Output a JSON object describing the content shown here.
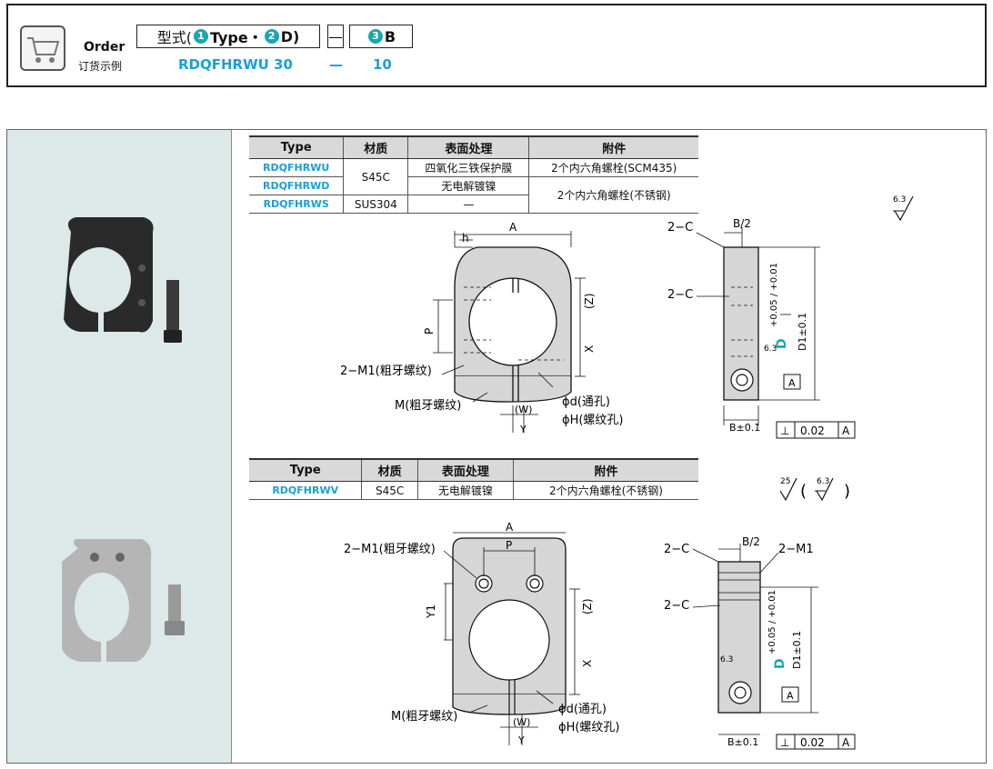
{
  "order": {
    "title_en": "Order",
    "title_cn": "订货示例",
    "type_label_prefix": "型式(",
    "type_label_part1": "Type・",
    "type_label_part2": "D)",
    "circle1": "1",
    "circle2": "2",
    "circle3": "3",
    "b_label": "B",
    "dash": "—",
    "example_type": "RDQFHRWU 30",
    "example_b": "10"
  },
  "table1": {
    "headers": [
      "Type",
      "材质",
      "表面处理",
      "附件"
    ],
    "rows": [
      {
        "type": "RDQFHRWU",
        "material": "S45C",
        "surface": "四氧化三铁保护膜",
        "accessory": "2个内六角螺栓(SCM435)"
      },
      {
        "type": "RDQFHRWD",
        "surface": "无电解镀镍",
        "accessory": "2个内六角螺栓(不锈钢)"
      },
      {
        "type": "RDQFHRWS",
        "material": "SUS304",
        "surface": "—"
      }
    ]
  },
  "table2": {
    "headers": [
      "Type",
      "材质",
      "表面处理",
      "附件"
    ],
    "rows": [
      {
        "type": "RDQFHRWV",
        "material": "S45C",
        "surface": "无电解镀镍",
        "accessory": "2个内六角螺栓(不锈钢)"
      }
    ]
  },
  "drawing1": {
    "A": "A",
    "h": "h",
    "P": "P",
    "Z": "(Z)",
    "X": "X",
    "m1": "2−M1(粗牙螺纹)",
    "m": "M(粗牙螺纹)",
    "W": "(W)",
    "Y": "Y",
    "phid": "ϕd(通孔)",
    "phiH": "ϕH(螺纹孔)",
    "B2": "B/2",
    "C1": "2−C",
    "C2": "2−C",
    "D_tol": "+0.05 / +0.01",
    "D": "D",
    "D1": "D1±0.1",
    "A_ref": "A",
    "r63": "6.3",
    "B_tol": "B±0.1",
    "perp": "⊥",
    "perp_val": "0.02",
    "perp_ref": "A"
  },
  "drawing2": {
    "A": "A",
    "P": "P",
    "Y1": "Y1",
    "Z": "(Z)",
    "X": "X",
    "m1": "2−M1(粗牙螺纹)",
    "m": "M(粗牙螺纹)",
    "W": "(W)",
    "Y": "Y",
    "phid": "ϕd(通孔)",
    "phiH": "ϕH(螺纹孔)",
    "B2": "B/2",
    "C1": "2−C",
    "C2": "2−C",
    "M1": "2−M1",
    "D_tol": "+0.05 / +0.01",
    "D": "D",
    "D1": "D1±0.1",
    "A_ref": "A",
    "r63": "6.3",
    "B_tol": "B±0.1",
    "perp": "⊥",
    "perp_val": "0.02",
    "perp_ref": "A"
  },
  "roughness": {
    "sym1": "6.3",
    "sym2a": "25",
    "sym2b": "6.3"
  },
  "colors": {
    "cyan": "#1a9fd9",
    "teal": "#19a7b2",
    "panel": "#dde9e9"
  }
}
